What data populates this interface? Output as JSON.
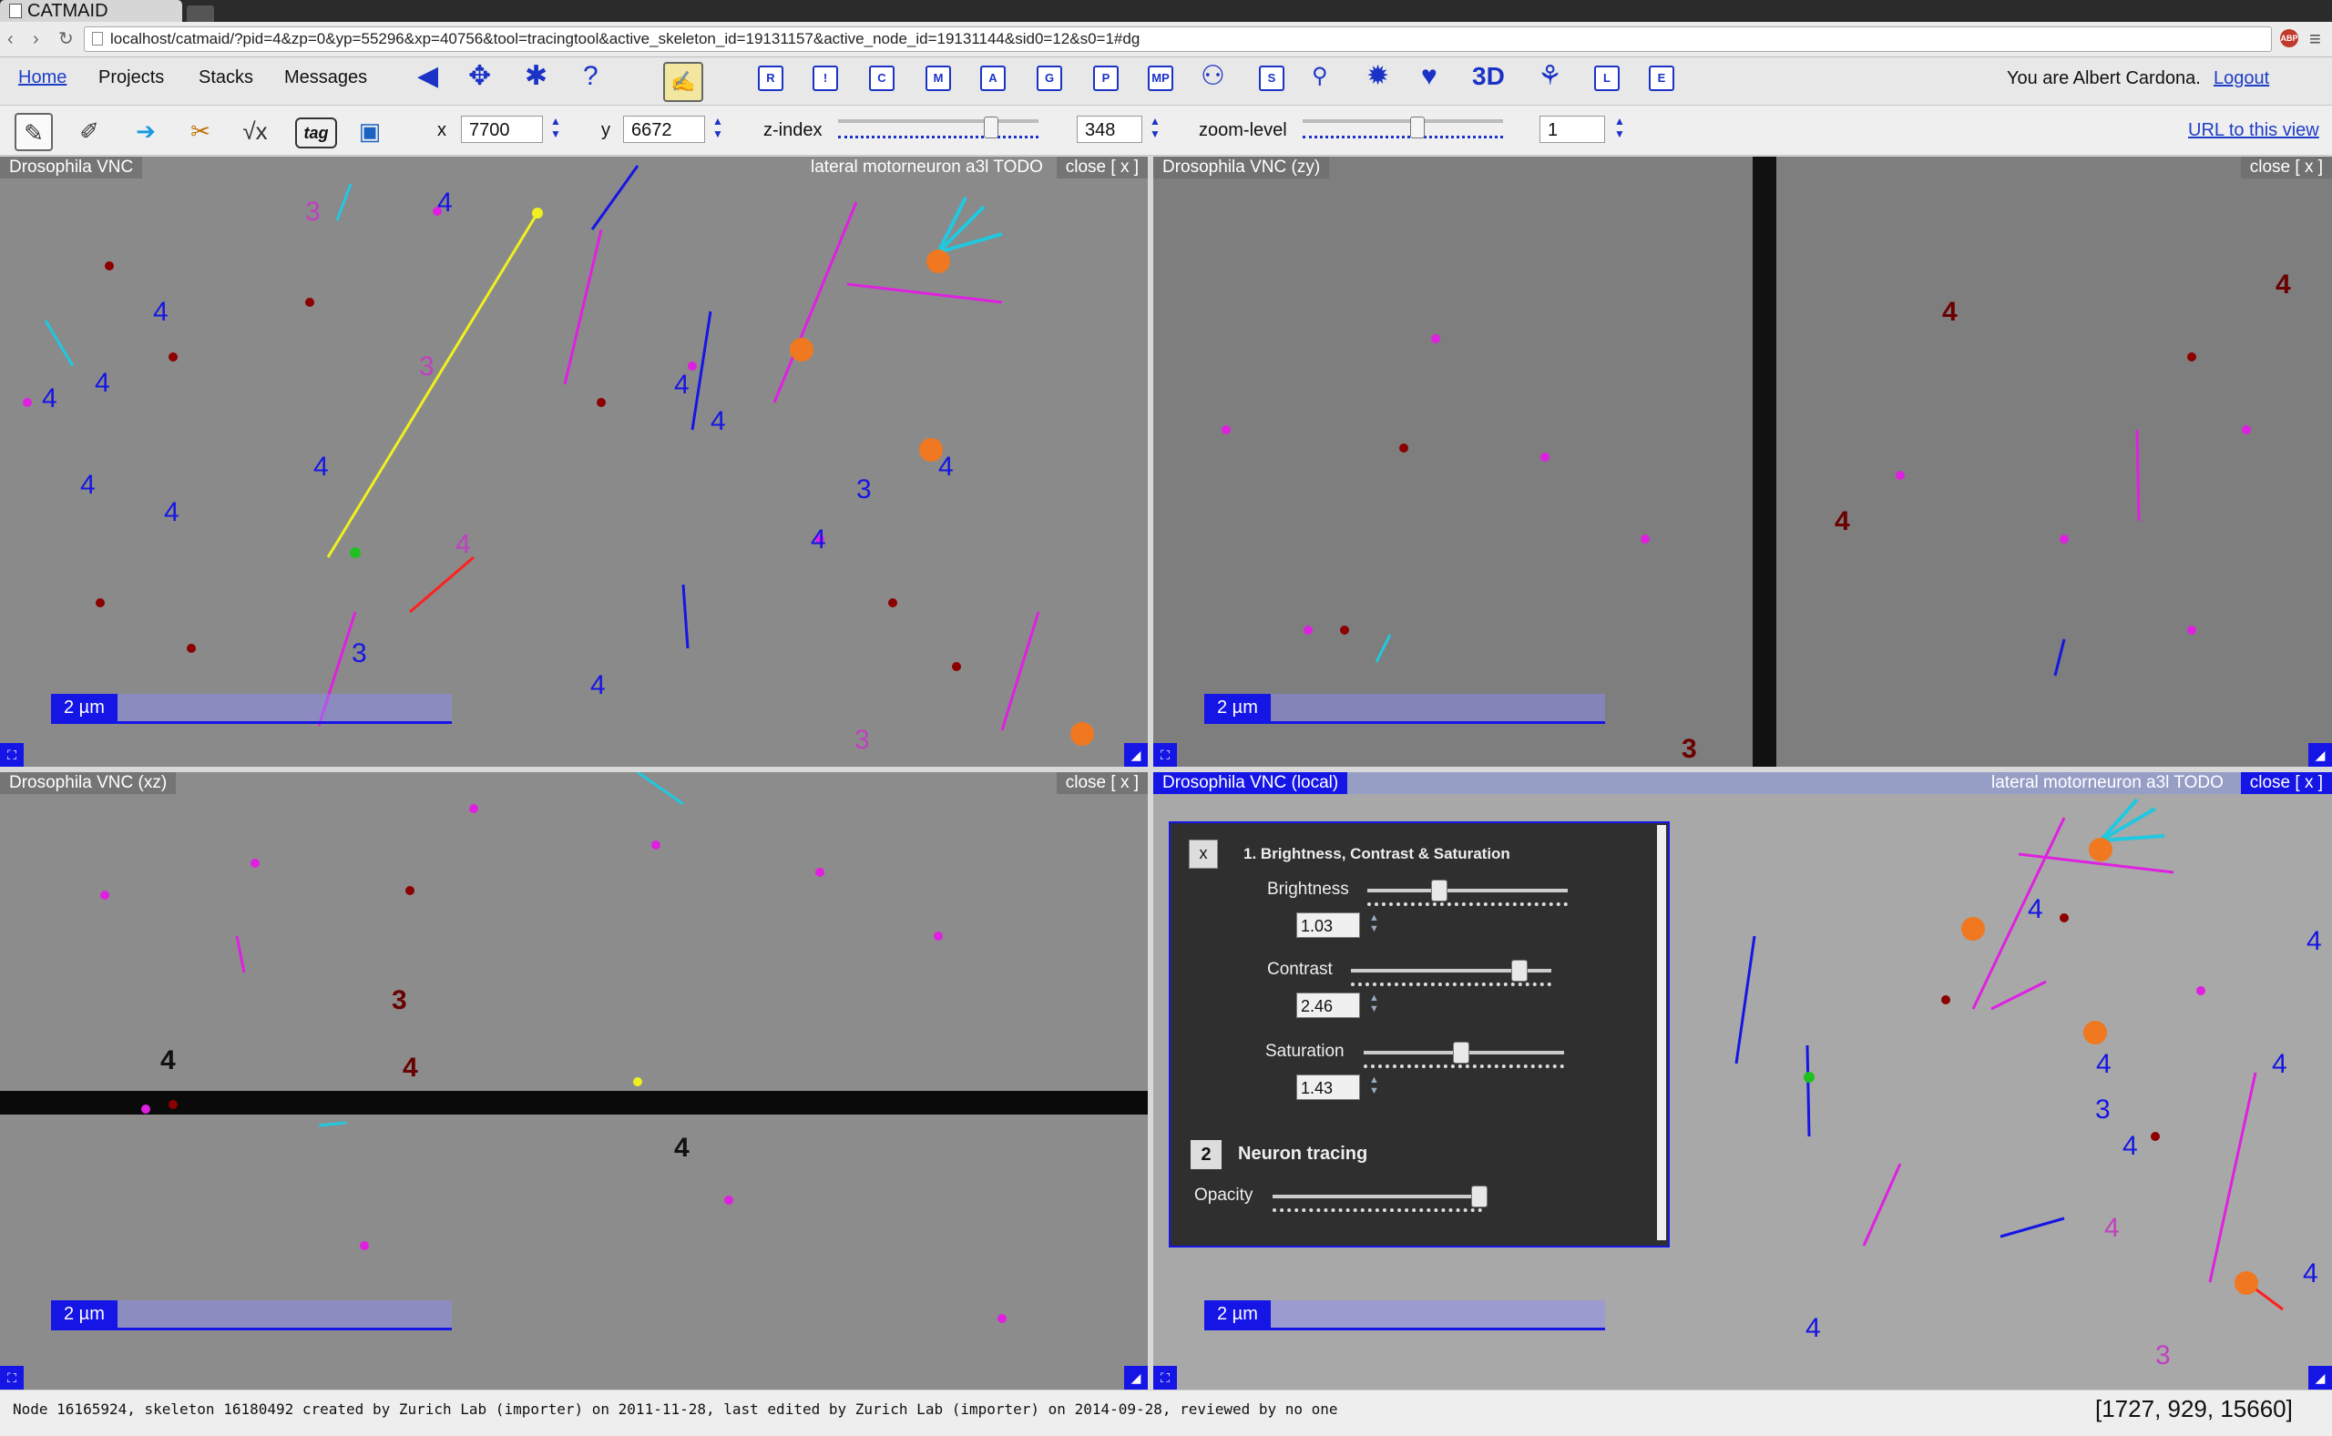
{
  "browser": {
    "tab_title": "CATMAID",
    "url": "localhost/catmaid/?pid=4&zp=0&yp=55296&xp=40756&tool=tracingtool&active_skeleton_id=19131157&active_node_id=19131144&sid0=12&s0=1#dg"
  },
  "menubar": {
    "home": "Home",
    "projects": "Projects",
    "stacks": "Stacks",
    "messages": "Messages",
    "help": "?",
    "user_text": "You are Albert Cardona.",
    "logout": "Logout",
    "tool_letters": [
      "R",
      "!",
      "C",
      "M",
      "A",
      "G",
      "P",
      "MP",
      "S"
    ],
    "tool_letters2": [
      "L",
      "E"
    ],
    "three_d": "3D"
  },
  "toolbar": {
    "tag_label": "tag",
    "x_label": "x",
    "x_value": "7700",
    "y_label": "y",
    "y_value": "6672",
    "zindex_label": "z-index",
    "zindex_value": "348",
    "zoom_label": "zoom-level",
    "zoom_value": "1",
    "url_link": "URL to this view"
  },
  "panels": {
    "top_left": {
      "title": "Drosophila VNC",
      "neuron": "lateral motorneuron a3l TODO",
      "close": "close [ x ]",
      "scale": "2 µm"
    },
    "top_right": {
      "title": "Drosophila VNC (zy)",
      "close": "close [ x ]",
      "scale": "2 µm"
    },
    "bottom_left": {
      "title": "Drosophila VNC (xz)",
      "close": "close [ x ]",
      "scale": "2 µm"
    },
    "bottom_right": {
      "title": "Drosophila VNC (local)",
      "neuron": "lateral motorneuron a3l TODO",
      "close": "close [ x ]",
      "scale": "2 µm"
    }
  },
  "dialog": {
    "close": "x",
    "layer1_title": "1.  Brightness, Contrast & Saturation",
    "brightness_label": "Brightness",
    "brightness_value": "1.03",
    "contrast_label": "Contrast",
    "contrast_value": "2.46",
    "saturation_label": "Saturation",
    "saturation_value": "1.43",
    "layer2_num": "2",
    "layer2_title": "Neuron tracing",
    "opacity_label": "Opacity"
  },
  "status": {
    "text": "Node 16165924, skeleton 16180492 created by Zurich Lab (importer) on 2011-11-28, last edited by Zurich Lab (importer) on 2014-09-28, reviewed by no one",
    "coords": "[1727, 929, 15660]"
  },
  "node_labels": {
    "tl": [
      "4",
      "3",
      "4",
      "4",
      "3",
      "4",
      "4",
      "4",
      "4",
      "3",
      "4",
      "4",
      "3",
      "4",
      "4",
      "4",
      "4",
      "3"
    ],
    "tr": [
      "4",
      "4",
      "4",
      "3"
    ],
    "bl": [
      "3",
      "4",
      "4",
      "4"
    ],
    "br": [
      "4",
      "4",
      "4",
      "4",
      "3",
      "4",
      "4",
      "3",
      "4",
      "4"
    ]
  },
  "colors": {
    "accent_blue": "#1515e6",
    "link_blue": "#1e3ec8",
    "node_magenta": "#e020e0",
    "node_orange": "#f07820",
    "node_cyan": "#20c8e0",
    "node_red": "#8b0000",
    "skeleton_yellow": "#f0f020"
  }
}
